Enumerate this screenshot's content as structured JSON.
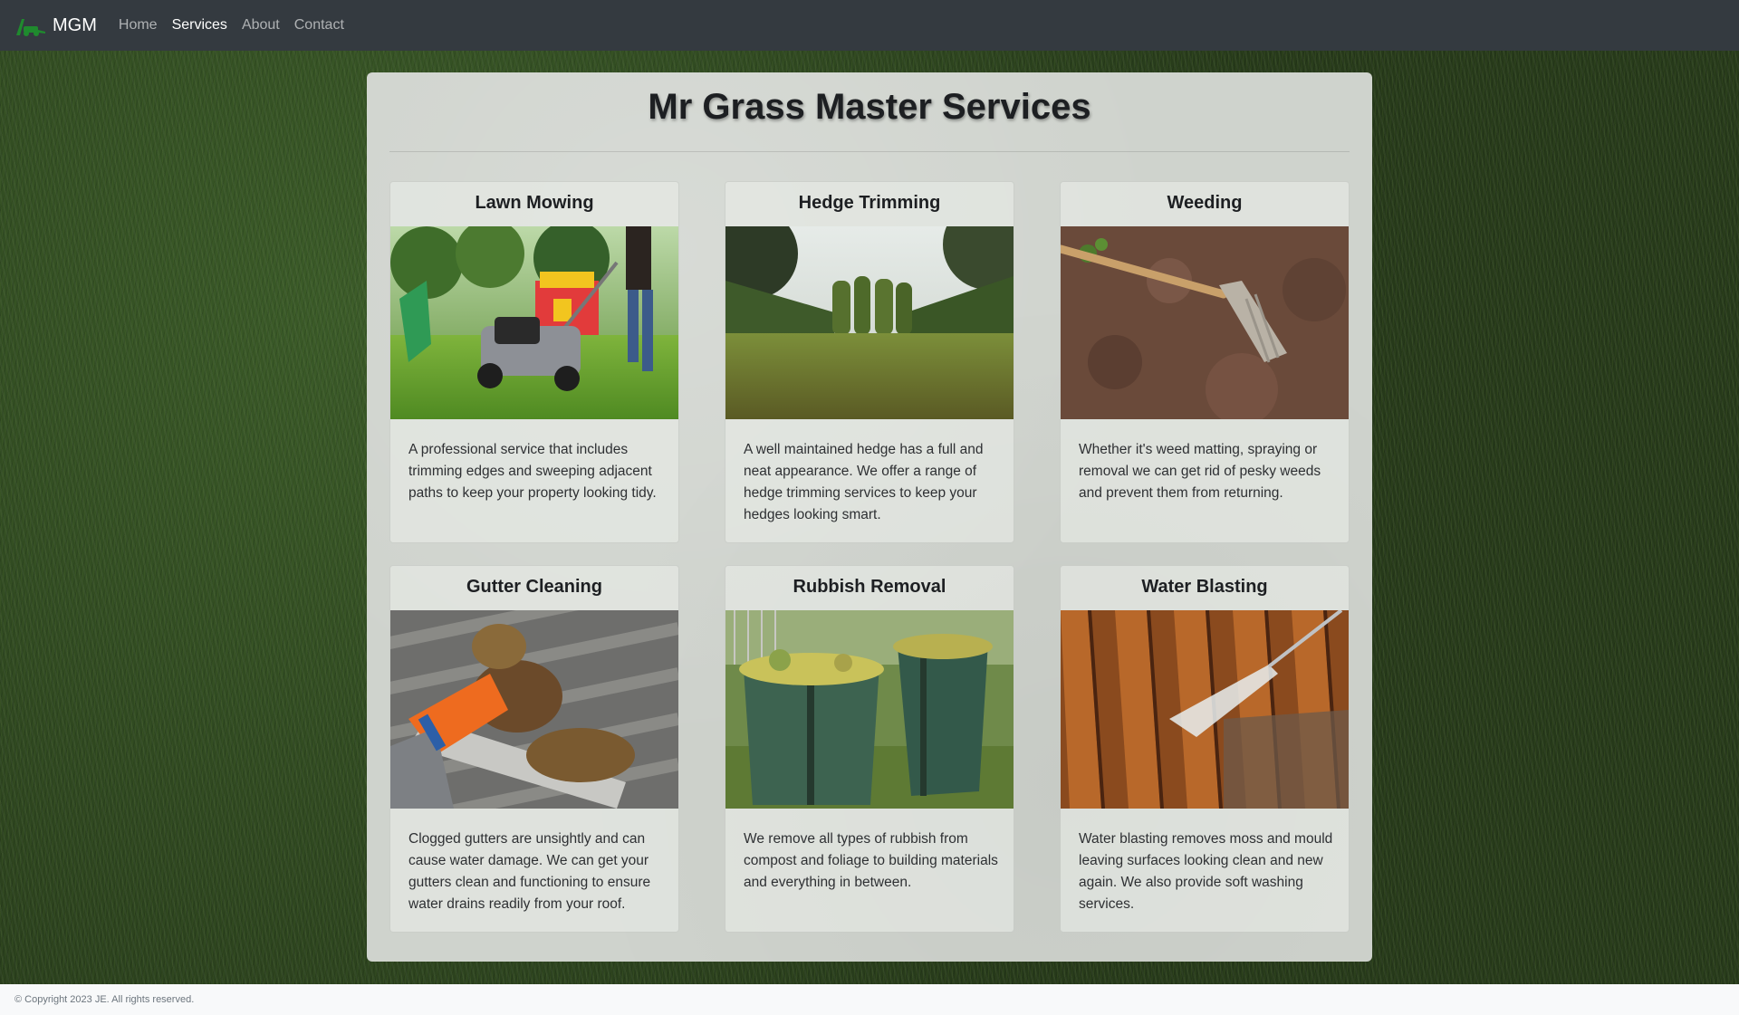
{
  "navbar": {
    "brand": "MGM",
    "links": [
      {
        "label": "Home"
      },
      {
        "label": "Services"
      },
      {
        "label": "About"
      },
      {
        "label": "Contact"
      }
    ]
  },
  "main": {
    "title": "Mr Grass Master Services",
    "services": [
      {
        "title": "Lawn Mowing",
        "text": "A professional service that includes trimming edges and sweeping adjacent paths to keep your property looking tidy.",
        "image": "lawn-mower-photo"
      },
      {
        "title": "Hedge Trimming",
        "text": "A well maintained hedge has a full and neat appearance. We offer a range of hedge trimming services to keep your hedges looking smart.",
        "image": "hedge-garden-photo"
      },
      {
        "title": "Weeding",
        "text": "Whether it's weed matting, spraying or removal we can get rid of pesky weeds and prevent them from returning.",
        "image": "rake-soil-photo"
      },
      {
        "title": "Gutter Cleaning",
        "text": "Clogged gutters are unsightly and can cause water damage. We can get your gutters clean and functioning to ensure water drains readily from your roof.",
        "image": "gutter-leaves-photo"
      },
      {
        "title": "Rubbish Removal",
        "text": "We remove all types of rubbish from compost and foliage to building materials and everything in between.",
        "image": "garden-bags-photo"
      },
      {
        "title": "Water Blasting",
        "text": "Water blasting removes moss and mould leaving surfaces looking clean and new again. We also provide soft washing services.",
        "image": "deck-water-blast-photo"
      }
    ]
  },
  "footer": {
    "copyright": "© Copyright 2023 JE. All rights reserved."
  },
  "colors": {
    "navbar": "#343a40",
    "brand_icon": "#1f8a2e",
    "panel": "#cfd3cd",
    "footer": "#f8f9fa"
  }
}
